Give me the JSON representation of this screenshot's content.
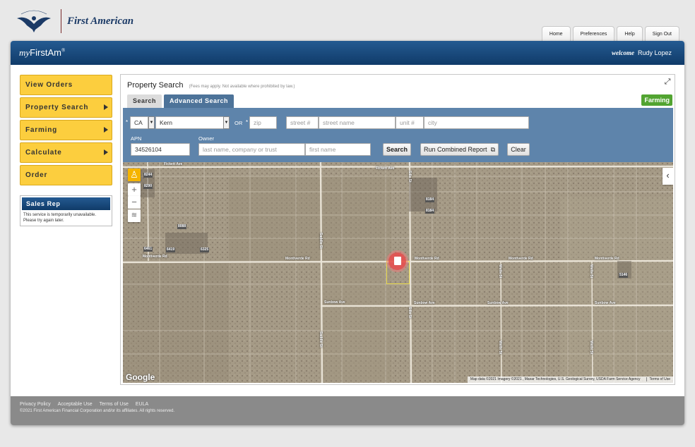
{
  "brand": {
    "name": "First American",
    "eagle_text": "FIRST AMERICAN"
  },
  "top_nav": [
    {
      "label": "Home"
    },
    {
      "label": "Preferences"
    },
    {
      "label": "Help"
    },
    {
      "label": "Sign Out"
    }
  ],
  "header": {
    "logo_prefix": "my",
    "logo_main": "FirstAm",
    "logo_mark": "®",
    "welcome_label": "welcome",
    "user_name": "Rudy Lopez"
  },
  "sidebar": {
    "items": [
      {
        "label": "View Orders",
        "has_submenu": false
      },
      {
        "label": "Property Search",
        "has_submenu": true
      },
      {
        "label": "Farming",
        "has_submenu": true
      },
      {
        "label": "Calculate",
        "has_submenu": true
      },
      {
        "label": "Order",
        "has_submenu": false
      }
    ],
    "sales_rep": {
      "title": "Sales Rep",
      "message": "This service is temporarily unavailable. Please try again later."
    }
  },
  "panel": {
    "title": "Property Search",
    "note": "(Fees may apply. Not available where prohibited by law.)",
    "tabs": [
      {
        "label": "Search",
        "active": false
      },
      {
        "label": "Advanced Search",
        "active": true
      }
    ],
    "farming_badge": "Farming"
  },
  "form": {
    "required_mark": "*",
    "state": {
      "value": "CA"
    },
    "county": {
      "value": "Kern"
    },
    "or_label": "OR",
    "zip": {
      "placeholder": "zip"
    },
    "street_number": {
      "placeholder": "street #"
    },
    "street_name": {
      "placeholder": "street name"
    },
    "unit": {
      "placeholder": "unit #"
    },
    "city": {
      "placeholder": "city"
    },
    "apn_label": "APN",
    "apn": {
      "value": "34526104"
    },
    "owner_label": "Owner",
    "owner_last": {
      "placeholder": "last name, company or trust"
    },
    "owner_first": {
      "placeholder": "first name"
    },
    "search_label": "Search",
    "combined_label": "Run Combined Report",
    "clear_label": "Clear"
  },
  "map": {
    "roads": {
      "fickett": "Fickett Ave",
      "montiverde": "Montiverde Rd",
      "sunbow": "Sunbow Ave",
      "street_west": "Saddle St",
      "street_east": "Sills St",
      "street_center": "Wells St"
    },
    "parcels": [
      "8244",
      "8290",
      "8184",
      "8184",
      "8088",
      "6461",
      "6419",
      "6325",
      "5146"
    ],
    "google": "Google",
    "attribution": "Map data ©2021 Imagery ©2021 , Maxar Technologies, U.S. Geological Survey, USDA Farm Service Agency",
    "terms": "Terms of Use",
    "icons": {
      "pegman": "person-icon",
      "zoom_in": "plus-icon",
      "zoom_out": "minus-icon",
      "layers": "layers-icon",
      "collapse": "chevron-left-icon",
      "expand": "expand-icon",
      "report": "copy-icon"
    }
  },
  "footer": {
    "links": [
      {
        "label": "Privacy Policy"
      },
      {
        "label": "Acceptable Use"
      },
      {
        "label": "Terms of Use"
      },
      {
        "label": "EULA"
      }
    ],
    "copyright": "©2021 First American Financial Corporation and/or its affiliates. All rights reserved."
  },
  "colors": {
    "header_blue": "#1a4a7d",
    "nav_yellow": "#fcce3e",
    "form_blue": "#5e84ab",
    "farming_green": "#52a431"
  }
}
